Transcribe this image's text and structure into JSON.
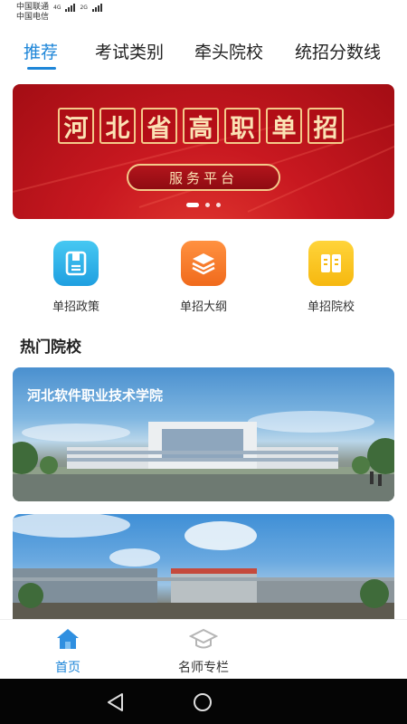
{
  "status_bar": {
    "carrier1": "中国联通",
    "carrier2": "中国电信",
    "net1": "4G",
    "net2": "2G"
  },
  "tabs": [
    {
      "label": "推荐",
      "active": true
    },
    {
      "label": "考试类别"
    },
    {
      "label": "牵头院校"
    },
    {
      "label": "统招分数线"
    }
  ],
  "banner": {
    "title_chars": [
      "河",
      "北",
      "省",
      "高",
      "职",
      "单",
      "招"
    ],
    "subtitle": "服务平台",
    "slide_count": 3,
    "active_slide": 1
  },
  "grid": [
    {
      "label": "单招政策",
      "icon": "document-icon",
      "color": "#2fb4ea"
    },
    {
      "label": "单招大纲",
      "icon": "layers-icon",
      "color": "#f57a2a"
    },
    {
      "label": "单招院校",
      "icon": "book-icon",
      "color": "#f7c21b"
    }
  ],
  "section": {
    "title": "热门院校"
  },
  "cards": [
    {
      "title": "河北软件职业技术学院"
    },
    {
      "title": ""
    }
  ],
  "bottom_nav": [
    {
      "label": "首页",
      "icon": "home-icon",
      "active": true
    },
    {
      "label": "名师专栏",
      "icon": "graduation-cap-icon",
      "active": false
    }
  ],
  "colors": {
    "accent": "#1e86d8",
    "banner_red": "#c81820"
  }
}
